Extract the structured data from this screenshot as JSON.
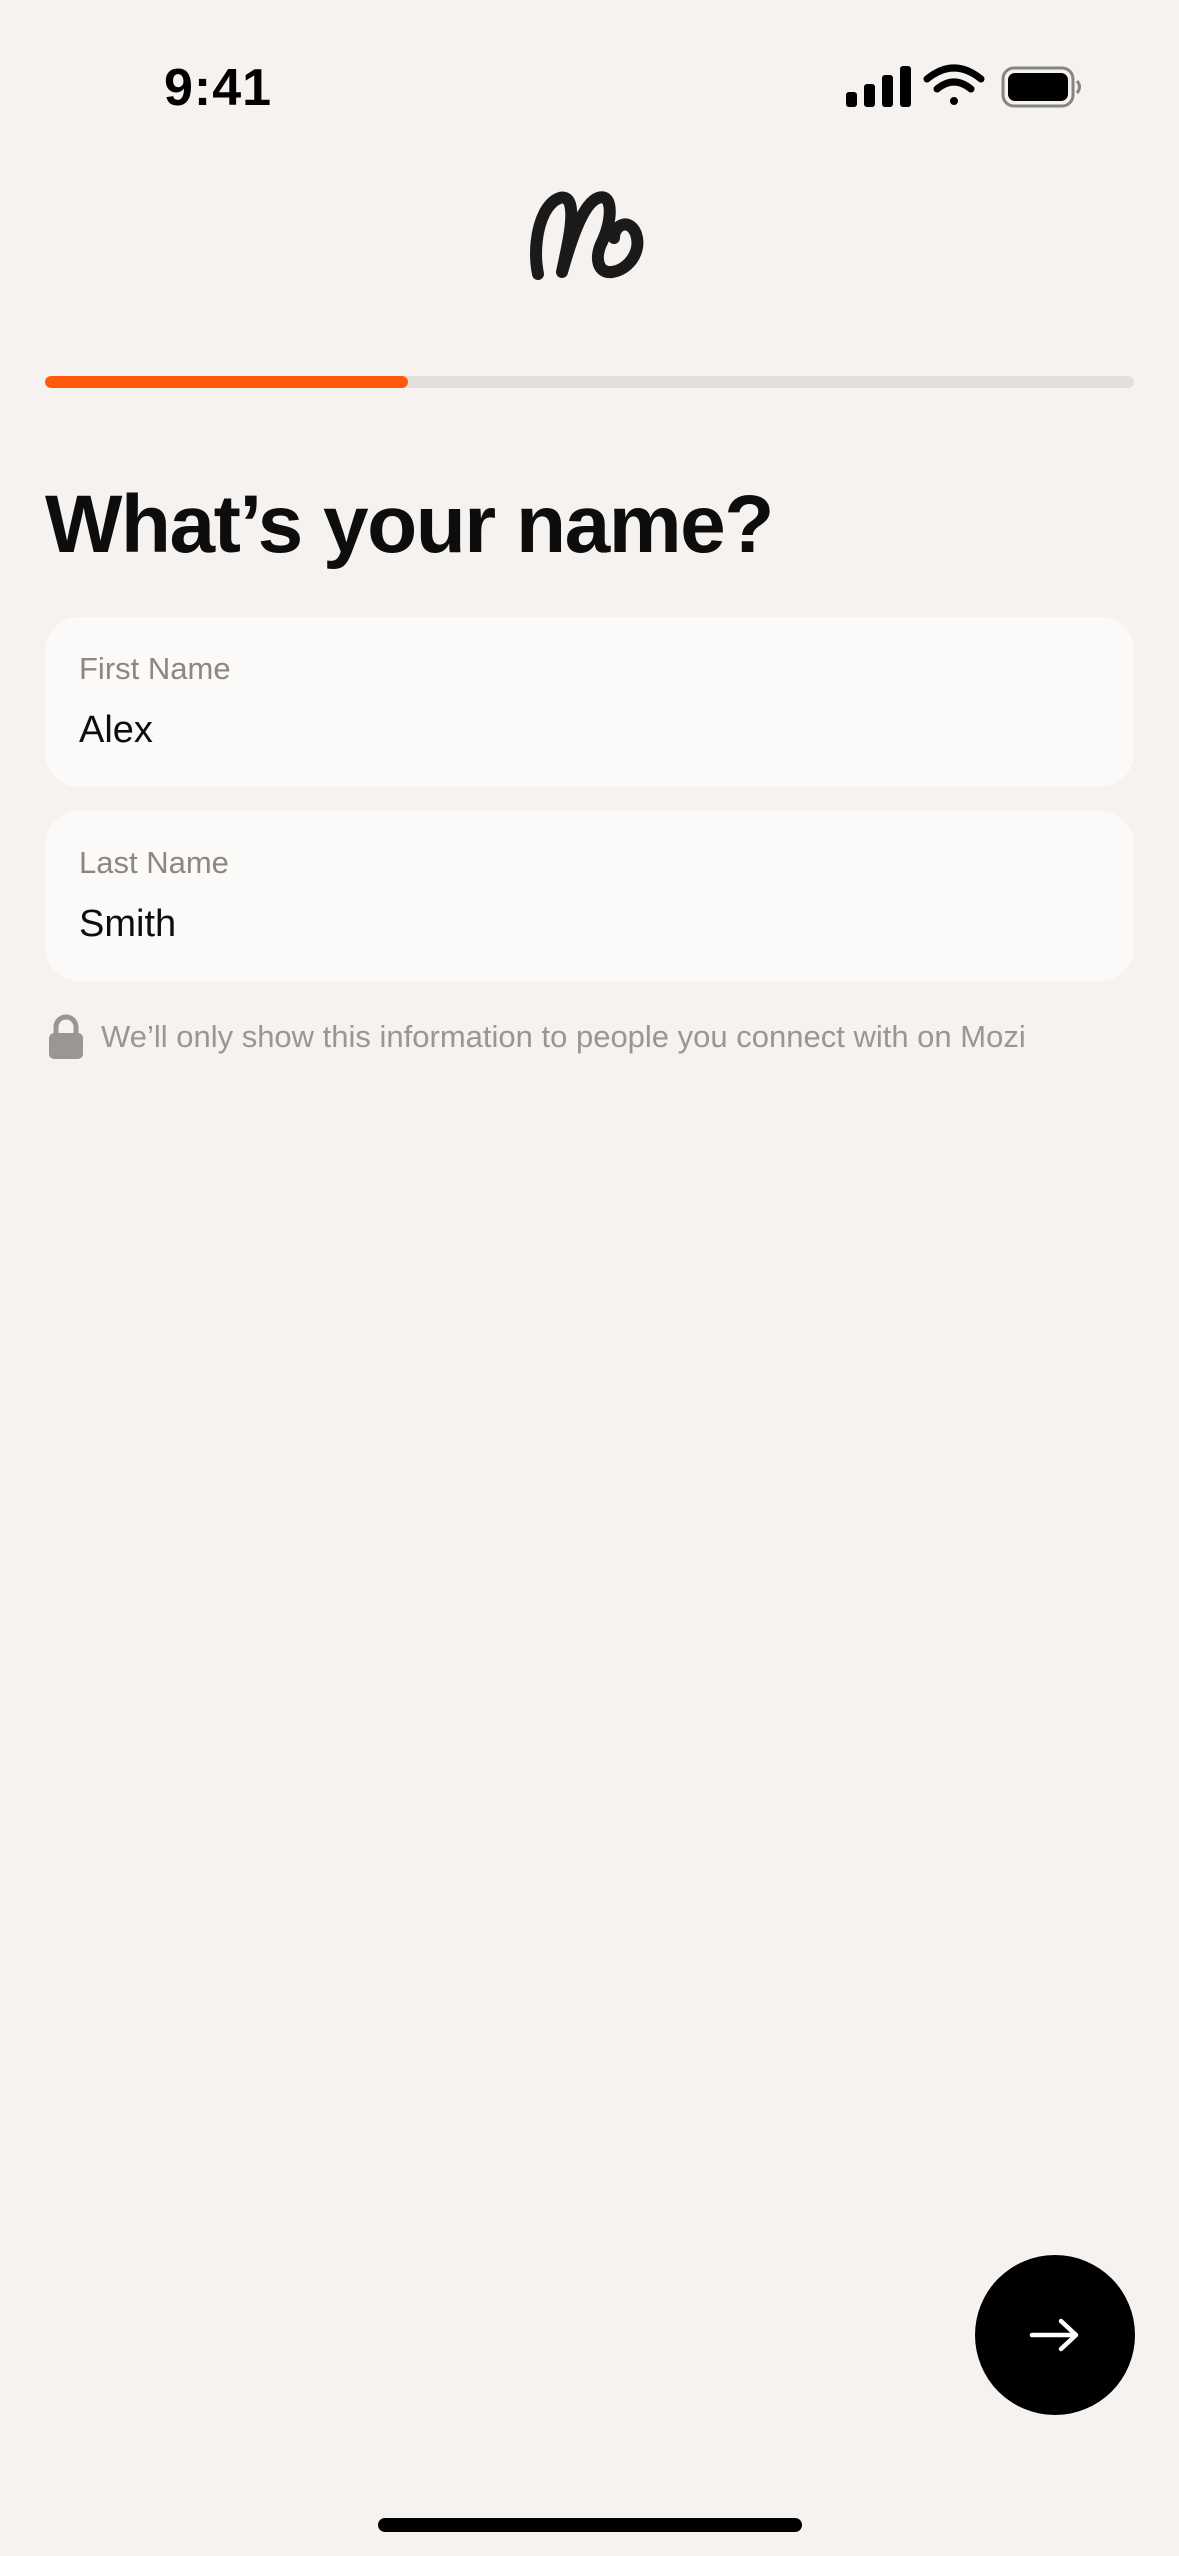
{
  "status_bar": {
    "time": "9:41",
    "icons": [
      "cellular-signal-icon",
      "wifi-icon",
      "battery-icon"
    ]
  },
  "brand": {
    "logo_icon": "mozi-script-logo-icon"
  },
  "progress": {
    "fraction": 0.333,
    "accent_color": "#ff5a0a",
    "track_color": "#e3dfda"
  },
  "screen": {
    "title": "What’s your name?"
  },
  "fields": {
    "first_name": {
      "label": "First Name",
      "value": "Alex"
    },
    "last_name": {
      "label": "Last Name",
      "value": "Smith"
    }
  },
  "privacy": {
    "icon": "lock-icon",
    "text": "We’ll only show this information to people you connect with on Mozi"
  },
  "next_button": {
    "icon": "arrow-right-icon",
    "background": "#000000"
  }
}
